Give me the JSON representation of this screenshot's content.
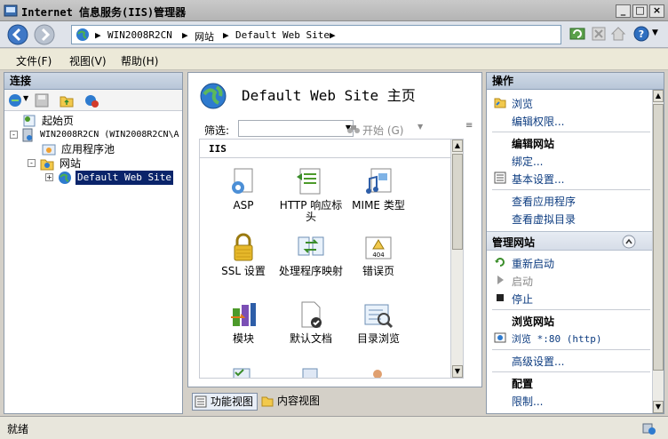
{
  "window": {
    "title": "Internet 信息服务(IIS)管理器"
  },
  "address": {
    "crumbs": [
      "WIN2008R2CN",
      "网站",
      "Default Web Site"
    ]
  },
  "menu": [
    "文件(F)",
    "视图(V)",
    "帮助(H)"
  ],
  "connections": {
    "title": "连接",
    "tree": [
      {
        "label": "起始页"
      },
      {
        "label": "WIN2008R2CN (WIN2008R2CN\\A"
      },
      {
        "label": "应用程序池"
      },
      {
        "label": "网站"
      },
      {
        "label": "Default Web Site",
        "selected": true
      }
    ]
  },
  "center": {
    "title": "Default Web Site 主页",
    "filter_label": "筛选:",
    "start_label": "开始 (G)",
    "group": "IIS",
    "features": [
      {
        "label": "ASP",
        "icon": "asp-icon"
      },
      {
        "label": "HTTP 响应标头",
        "icon": "http-headers-icon"
      },
      {
        "label": "MIME 类型",
        "icon": "mime-types-icon"
      },
      {
        "label": "SSL 设置",
        "icon": "ssl-lock-icon"
      },
      {
        "label": "处理程序映射",
        "icon": "handler-mappings-icon"
      },
      {
        "label": "错误页",
        "icon": "error-page-404-icon"
      },
      {
        "label": "模块",
        "icon": "modules-icon"
      },
      {
        "label": "默认文档",
        "icon": "default-document-icon"
      },
      {
        "label": "目录浏览",
        "icon": "directory-browsing-icon"
      }
    ],
    "views": {
      "features": "功能视图",
      "content": "内容视图"
    }
  },
  "actions": {
    "title": "操作",
    "browse": "浏览",
    "edit_permissions": "编辑权限...",
    "edit_site": "编辑网站",
    "bindings": "绑定...",
    "basic_settings": "基本设置...",
    "view_apps": "查看应用程序",
    "view_vdirs": "查看虚拟目录",
    "manage_site": "管理网站",
    "restart": "重新启动",
    "start": "启动",
    "stop": "停止",
    "browse_site": "浏览网站",
    "browse_http": "浏览 *:80 (http)",
    "advanced": "高级设置...",
    "config": "配置",
    "limits": "限制..."
  },
  "status": "就绪",
  "colors": {
    "accent": "#0a246a",
    "link": "#0d3c80"
  }
}
